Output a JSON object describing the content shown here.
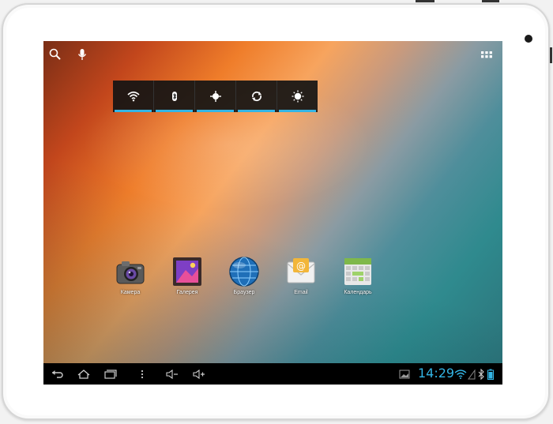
{
  "device": {
    "name": "android-tablet"
  },
  "top_bar": {
    "search_icon": "search-icon",
    "voice_icon": "microphone-icon",
    "apps_icon": "all-apps-grid-icon"
  },
  "quick_settings": [
    {
      "name": "wifi",
      "icon": "wifi-icon",
      "active": true
    },
    {
      "name": "bluetooth",
      "icon": "bluetooth-icon",
      "active": true
    },
    {
      "name": "gps",
      "icon": "gps-icon",
      "active": true
    },
    {
      "name": "sync",
      "icon": "sync-icon",
      "active": true
    },
    {
      "name": "brightness",
      "icon": "brightness-icon",
      "active": true
    }
  ],
  "apps": [
    {
      "label": "Камера",
      "icon": "camera-icon"
    },
    {
      "label": "Галерея",
      "icon": "gallery-icon"
    },
    {
      "label": "Браузер",
      "icon": "browser-globe-icon"
    },
    {
      "label": "Email",
      "icon": "email-icon"
    },
    {
      "label": "Календарь",
      "icon": "calendar-icon"
    }
  ],
  "nav_bar": {
    "buttons": [
      "back-icon",
      "home-icon",
      "recent-apps-icon",
      "menu-icon",
      "volume-down-icon",
      "volume-up-icon"
    ],
    "status": {
      "time": "14:29",
      "icons": [
        "screenshot-icon",
        "wifi-icon",
        "signal-icon",
        "bluetooth-icon",
        "battery-icon"
      ]
    }
  },
  "colors": {
    "accent": "#33b5e5",
    "navbar": "#000000",
    "widget": "#141414"
  }
}
